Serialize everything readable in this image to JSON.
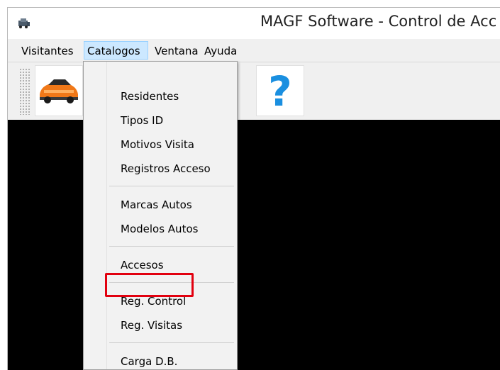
{
  "window": {
    "title": "MAGF Software - Control de Acc"
  },
  "menubar": {
    "items": [
      {
        "label": "Visitantes"
      },
      {
        "label": "Catalogos"
      },
      {
        "label": "Ventana"
      },
      {
        "label": "Ayuda"
      }
    ]
  },
  "toolbar": {
    "icons": [
      "car-icon",
      "help-icon"
    ],
    "help_glyph": "?"
  },
  "catalogos_menu": {
    "items": [
      {
        "label": "Residentes"
      },
      {
        "label": "Tipos ID"
      },
      {
        "label": "Motivos Visita"
      },
      {
        "label": "Registros Acceso"
      },
      {
        "label": "Marcas Autos"
      },
      {
        "label": "Modelos Autos"
      },
      {
        "label": "Accesos"
      },
      {
        "label": "Reg. Control"
      },
      {
        "label": "Reg. Visitas"
      },
      {
        "label": "Carga D.B."
      }
    ],
    "highlighted": "Reg. Control"
  },
  "colors": {
    "workspace": "#000000",
    "menu_hover": "#cce8ff",
    "highlight_border": "#e2000f",
    "help_icon": "#1a8fe0",
    "car_body": "#f07818"
  }
}
